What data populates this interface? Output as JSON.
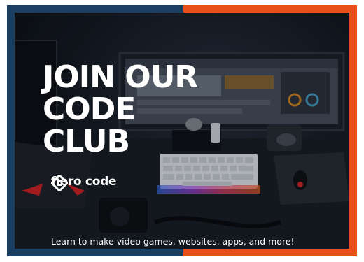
{
  "headline": {
    "line1": "JOIN OUR",
    "line2": "CODE",
    "line3": "CLUB"
  },
  "logo": {
    "icon": "fiero-code-logo-icon",
    "text": "fiero code"
  },
  "tagline": "Learn to make video games, websites, apps, and more!",
  "colors": {
    "border_left": "#1b3e63",
    "border_right": "#e8501a",
    "text": "#ffffff"
  }
}
